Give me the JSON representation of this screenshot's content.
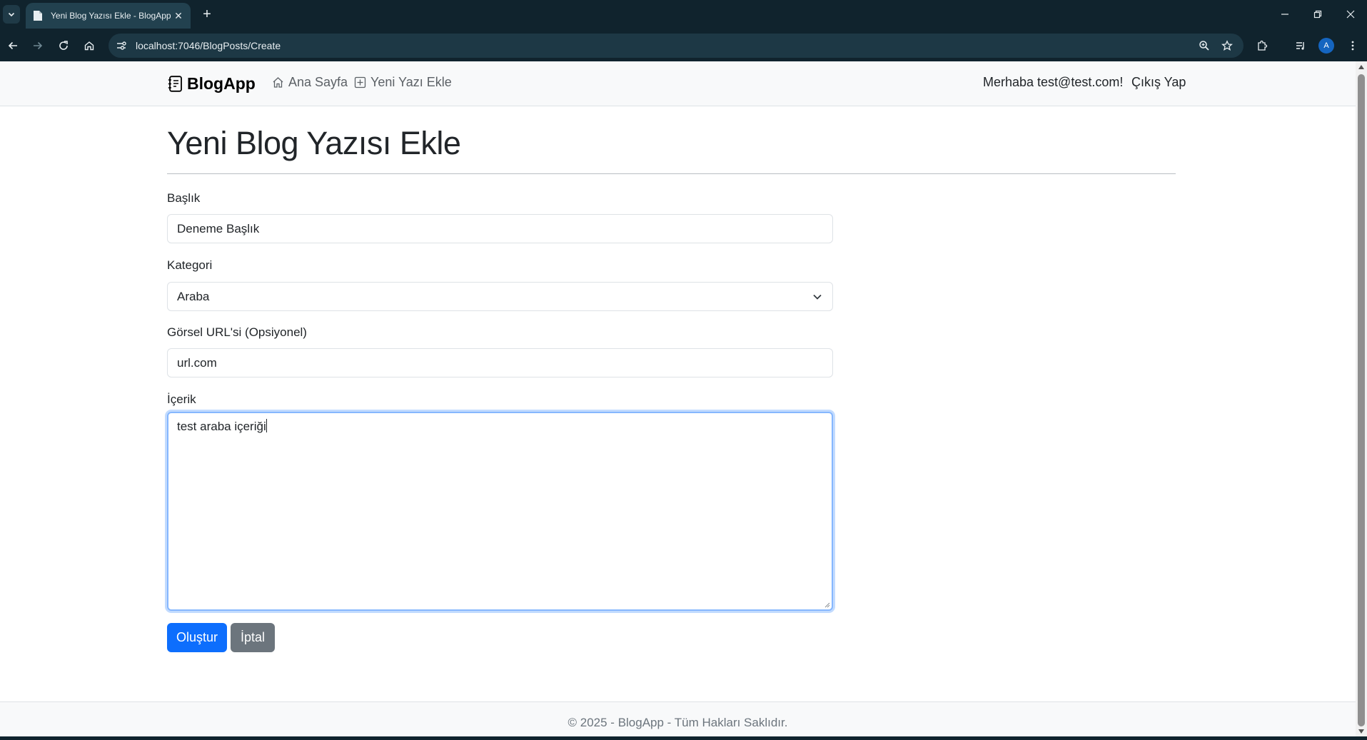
{
  "browser": {
    "tab_title": "Yeni Blog Yazısı Ekle - BlogApp",
    "url": "localhost:7046/BlogPosts/Create",
    "profile_initial": "A"
  },
  "navbar": {
    "brand": "BlogApp",
    "links": [
      {
        "label": "Ana Sayfa",
        "icon": "house-icon"
      },
      {
        "label": "Yeni Yazı Ekle",
        "icon": "plus-square-icon"
      }
    ],
    "greeting": "Merhaba test@test.com!",
    "logout": "Çıkış Yap"
  },
  "page": {
    "title": "Yeni Blog Yazısı Ekle"
  },
  "form": {
    "title_label": "Başlık",
    "title_value": "Deneme Başlık",
    "category_label": "Kategori",
    "category_value": "Araba",
    "image_label": "Görsel URL'si (Opsiyonel)",
    "image_value": "url.com",
    "content_label": "İçerik",
    "content_value": "test araba içeriği",
    "submit_label": "Oluştur",
    "cancel_label": "İptal"
  },
  "footer": {
    "text": "© 2025 - BlogApp - Tüm Hakları Saklıdır."
  },
  "colors": {
    "primary": "#0d6efd",
    "secondary": "#6c757d",
    "chrome_bg": "#10232d",
    "focus_border": "#86b7fe"
  }
}
